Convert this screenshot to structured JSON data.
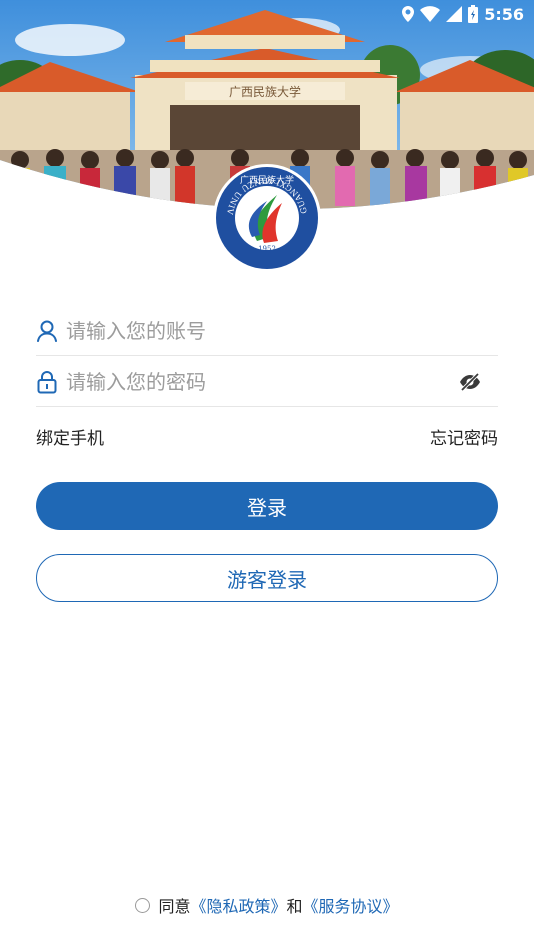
{
  "status_bar": {
    "time": "5:56",
    "icons": [
      "location-icon",
      "wifi-icon",
      "cellular-signal-icon",
      "battery-icon"
    ]
  },
  "hero": {
    "gate_sign": "广西民族大学"
  },
  "emblem": {
    "top_text": "广西民族大学",
    "ring_text": "GUANGXI MINZU UNIVERSITY",
    "year": "1952"
  },
  "form": {
    "account_placeholder": "请输入您的账号",
    "password_placeholder": "请输入您的密码",
    "bind_phone_label": "绑定手机",
    "forgot_password_label": "忘记密码",
    "login_label": "登录",
    "guest_login_label": "游客登录"
  },
  "agreement": {
    "prefix": "同意",
    "privacy_link": "《隐私政策》",
    "conjunction": "和",
    "service_link": "《服务协议》"
  },
  "colors": {
    "primary": "#1f68b5",
    "placeholder": "#9c9c9c",
    "divider": "#e6e6e6",
    "text": "#222222",
    "sky": "#4a9be0",
    "roof": "#d95b2a"
  }
}
